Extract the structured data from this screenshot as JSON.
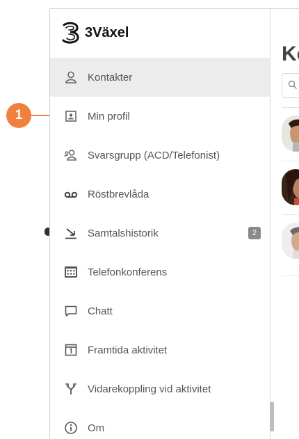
{
  "app": {
    "brand": "3Växel"
  },
  "sidebar": {
    "items": [
      {
        "label": "Kontakter",
        "icon": "contacts-icon",
        "active": true
      },
      {
        "label": "Min profil",
        "icon": "profile-card-icon"
      },
      {
        "label": "Svarsgrupp (ACD/Telefonist)",
        "icon": "group-icon"
      },
      {
        "label": "Röstbrevlåda",
        "icon": "voicemail-icon"
      },
      {
        "label": "Samtalshistorik",
        "icon": "call-history-icon",
        "badge": "2"
      },
      {
        "label": "Telefonkonferens",
        "icon": "conference-icon"
      },
      {
        "label": "Chatt",
        "icon": "chat-icon"
      },
      {
        "label": "Framtida aktivitet",
        "icon": "calendar-icon"
      },
      {
        "label": "Vidarekoppling vid aktivitet",
        "icon": "forward-icon"
      },
      {
        "label": "Om",
        "icon": "info-icon"
      }
    ]
  },
  "main": {
    "title": "Kontakter"
  },
  "callout": {
    "number": "1"
  },
  "colors": {
    "accent": "#f0803c",
    "active_bg": "#ececec",
    "badge_bg": "#8a8a8a"
  }
}
